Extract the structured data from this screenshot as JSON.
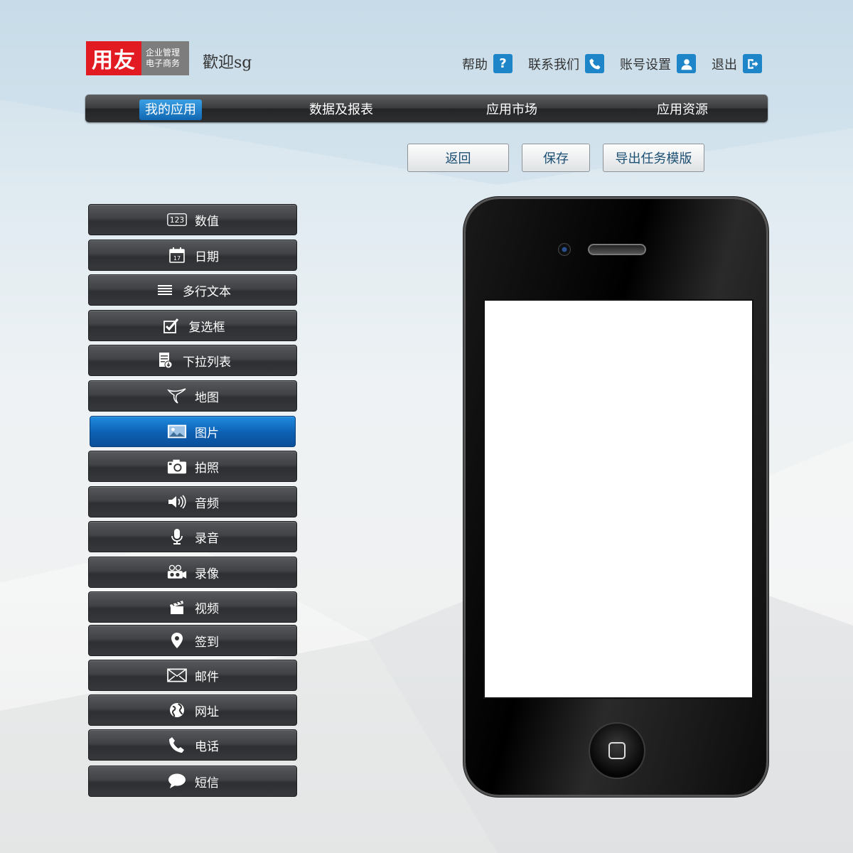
{
  "brand": {
    "logo_mark": "用友",
    "logo_sub_line1": "企业管理",
    "logo_sub_line2": "电子商务"
  },
  "welcome": "歡迎sg",
  "top_links": [
    {
      "label": "帮助",
      "icon": "question-icon"
    },
    {
      "label": "联系我们",
      "icon": "phone-icon"
    },
    {
      "label": "账号设置",
      "icon": "user-icon"
    },
    {
      "label": "退出",
      "icon": "exit-icon"
    }
  ],
  "nav": [
    {
      "label": "我的应用",
      "active": true
    },
    {
      "label": "数据及报表",
      "active": false
    },
    {
      "label": "应用市场",
      "active": false
    },
    {
      "label": "应用资源",
      "active": false
    }
  ],
  "actions": {
    "back": "返回",
    "save": "保存",
    "export": "导出任务模版"
  },
  "widgets": [
    {
      "label": "数值",
      "icon": "number-icon"
    },
    {
      "label": "日期",
      "icon": "calendar-icon"
    },
    {
      "label": "多行文本",
      "icon": "multiline-text-icon"
    },
    {
      "label": "复选框",
      "icon": "checkbox-icon"
    },
    {
      "label": "下拉列表",
      "icon": "dropdown-list-icon"
    },
    {
      "label": "地图",
      "icon": "map-icon"
    },
    {
      "label": "图片",
      "icon": "image-icon",
      "selected": true
    },
    {
      "label": "拍照",
      "icon": "camera-icon"
    },
    {
      "label": "音频",
      "icon": "speaker-icon"
    },
    {
      "label": "录音",
      "icon": "microphone-icon"
    },
    {
      "label": "录像",
      "icon": "video-camera-icon"
    },
    {
      "label": "视频",
      "icon": "clapperboard-icon"
    },
    {
      "label": "签到",
      "icon": "location-pin-icon"
    },
    {
      "label": "邮件",
      "icon": "mail-icon"
    },
    {
      "label": "网址",
      "icon": "globe-icon"
    },
    {
      "label": "电话",
      "icon": "phone-handset-icon"
    },
    {
      "label": "短信",
      "icon": "speech-bubble-icon"
    }
  ],
  "widget_number_icon_text": "123",
  "calendar_day": "17",
  "colors": {
    "brand_red": "#e21a22",
    "accent_blue": "#1e86c8",
    "nav_dark": "#2e2f31"
  }
}
